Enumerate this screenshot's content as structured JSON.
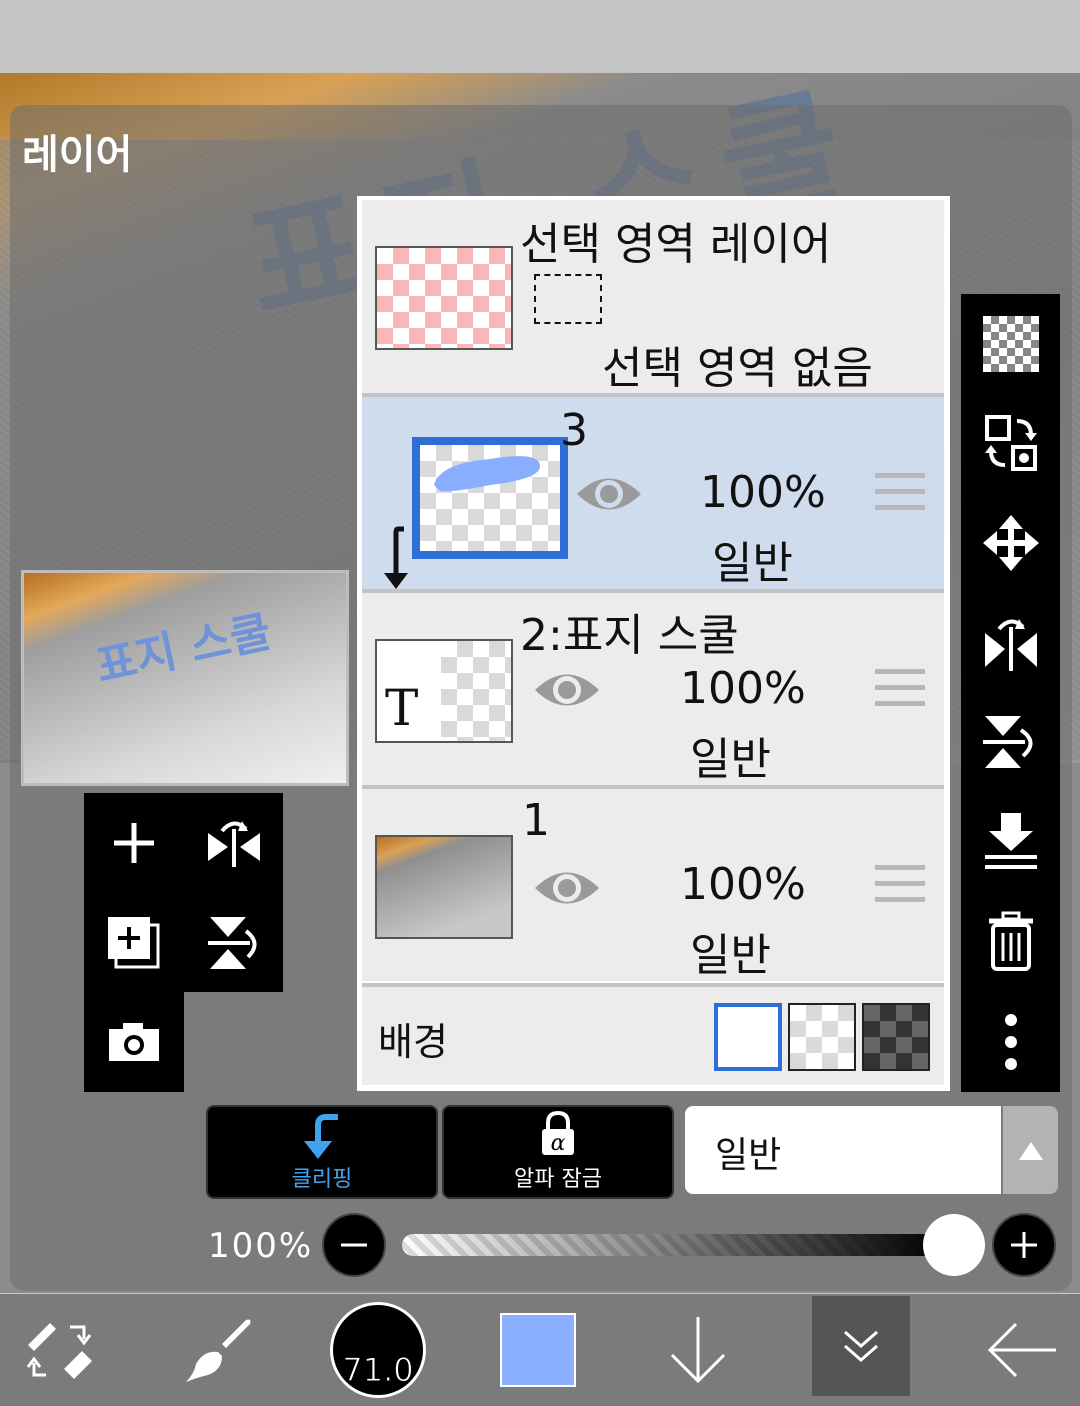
{
  "dialog": {
    "title": "레이어"
  },
  "canvas": {
    "watermark_text": "표지 스쿨"
  },
  "preview": {
    "text": "표지 스쿨"
  },
  "selection_layer": {
    "title": "선택 영역 레이어",
    "status": "선택 영역 없음"
  },
  "layers": [
    {
      "name": "3",
      "opacity": "100%",
      "mode": "일반",
      "active": true
    },
    {
      "name": "2:표지 스쿨",
      "opacity": "100%",
      "mode": "일반",
      "active": false,
      "type_glyph": "T"
    },
    {
      "name": "1",
      "opacity": "100%",
      "mode": "일반",
      "active": false
    }
  ],
  "background": {
    "label": "배경"
  },
  "actions": {
    "clipping_label": "클리핑",
    "alpha_lock_label": "알파 잠금",
    "blend_mode": "일반"
  },
  "opacity_control": {
    "label": "100%",
    "value": 1.0
  },
  "toolbar": {
    "brush_size": "71.0",
    "current_color": "#8ab0ff"
  },
  "colors": {
    "accent_blue": "#2d6fd6",
    "active_row": "#cfdcee"
  }
}
